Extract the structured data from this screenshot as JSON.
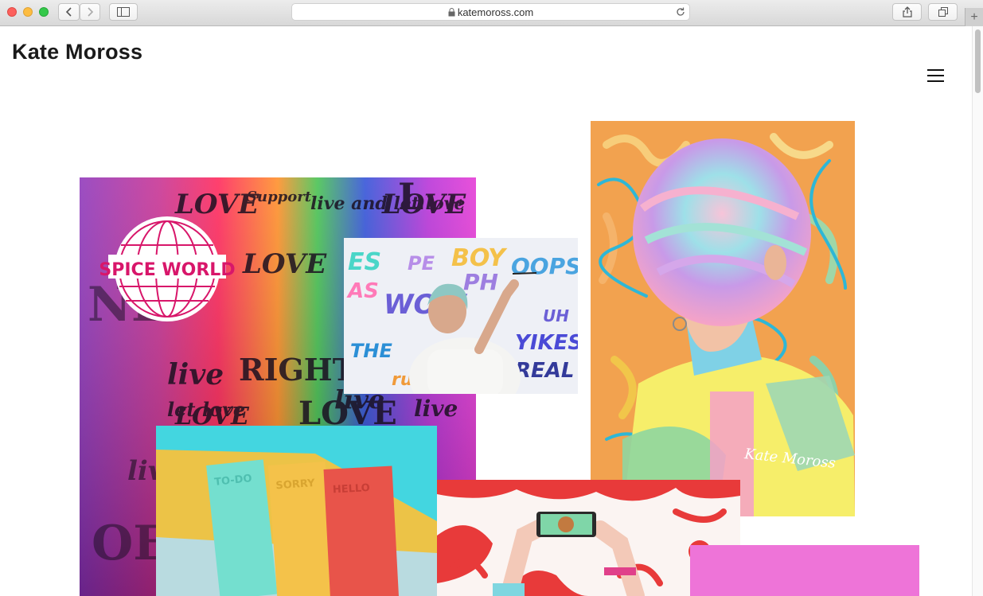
{
  "browser": {
    "url": "katemoross.com",
    "new_tab": "+"
  },
  "site": {
    "title": "Kate Moross"
  },
  "artwork": {
    "spiceworld_logo": "SPICE WORLD",
    "wall_words": [
      "LOVE",
      "Support",
      "live and let love",
      "LOVE",
      "LOVE",
      "live",
      "let love",
      "RIGHT",
      "LOVE",
      "LOVE"
    ],
    "mural_words": [
      "BOY",
      "OOPS",
      "WOW",
      "THE",
      "YIKES",
      "REAL",
      "UH"
    ],
    "notebook_words": [
      "TO-DO",
      "SORRY",
      "HELLO"
    ],
    "signature": "Kate Moross"
  },
  "colors": {
    "pink_tile": "#ee74d8",
    "orange_bg": "#f2a24f",
    "notebook_bg": "#43d6e0"
  }
}
